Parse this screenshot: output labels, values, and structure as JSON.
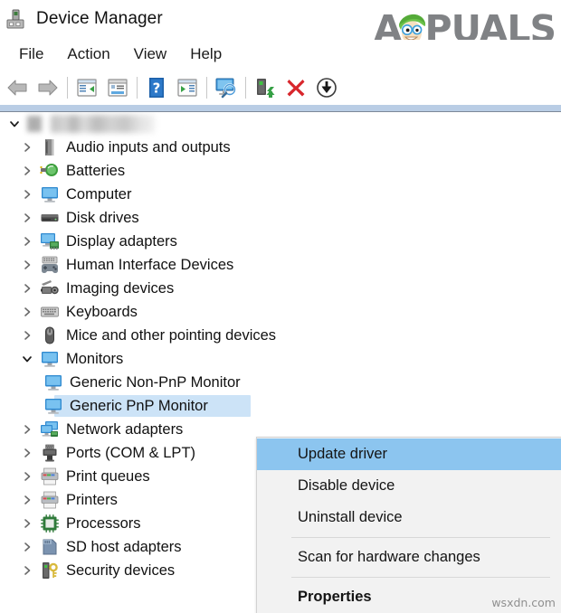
{
  "window": {
    "title": "Device Manager",
    "icon": "device-manager-icon"
  },
  "branding": {
    "logo_a": "A",
    "logo_rest": "PUALS",
    "watermark": "wsxdn.com"
  },
  "menubar": {
    "items": [
      {
        "label": "File",
        "name": "menu-file"
      },
      {
        "label": "Action",
        "name": "menu-action"
      },
      {
        "label": "View",
        "name": "menu-view"
      },
      {
        "label": "Help",
        "name": "menu-help"
      }
    ]
  },
  "toolbar": {
    "buttons": [
      {
        "name": "back-button",
        "icon": "back-arrow-icon",
        "tip": "Back"
      },
      {
        "name": "forward-button",
        "icon": "forward-arrow-icon",
        "tip": "Forward"
      },
      {
        "name": "show-hide-console-tree-button",
        "icon": "console-tree-icon",
        "tip": "Show/Hide Console Tree"
      },
      {
        "name": "properties-button",
        "icon": "properties-window-icon",
        "tip": "Properties"
      },
      {
        "name": "help-button",
        "icon": "help-question-icon",
        "tip": "Help"
      },
      {
        "name": "show-hide-action-pane-button",
        "icon": "action-pane-icon",
        "tip": "Show/Hide Action Pane"
      },
      {
        "name": "scan-for-hardware-changes-button",
        "icon": "scan-hardware-icon",
        "tip": "Scan for hardware changes"
      },
      {
        "name": "update-driver-button",
        "icon": "update-driver-icon",
        "tip": "Update driver"
      },
      {
        "name": "uninstall-device-button",
        "icon": "red-x-icon",
        "tip": "Uninstall device"
      },
      {
        "name": "disable-device-button",
        "icon": "circle-down-arrow-icon",
        "tip": "Disable device"
      }
    ]
  },
  "tree": {
    "root": {
      "label": "",
      "redacted": true,
      "expanded": true,
      "name": "tree-root-computer-name"
    },
    "items": [
      {
        "label": "Audio inputs and outputs",
        "icon": "speaker-icon",
        "indent": 1,
        "expanded": false,
        "selected": false
      },
      {
        "label": "Batteries",
        "icon": "battery-plug-icon",
        "indent": 1,
        "expanded": false,
        "selected": false
      },
      {
        "label": "Computer",
        "icon": "monitor-icon",
        "indent": 1,
        "expanded": false,
        "selected": false
      },
      {
        "label": "Disk drives",
        "icon": "disk-drive-icon",
        "indent": 1,
        "expanded": false,
        "selected": false
      },
      {
        "label": "Display adapters",
        "icon": "display-adapter-icon",
        "indent": 1,
        "expanded": false,
        "selected": false
      },
      {
        "label": "Human Interface Devices",
        "icon": "hid-gamepad-icon",
        "indent": 1,
        "expanded": false,
        "selected": false
      },
      {
        "label": "Imaging devices",
        "icon": "camera-icon",
        "indent": 1,
        "expanded": false,
        "selected": false
      },
      {
        "label": "Keyboards",
        "icon": "keyboard-icon",
        "indent": 1,
        "expanded": false,
        "selected": false
      },
      {
        "label": "Mice and other pointing devices",
        "icon": "mouse-icon",
        "indent": 1,
        "expanded": false,
        "selected": false
      },
      {
        "label": "Monitors",
        "icon": "monitor-icon",
        "indent": 1,
        "expanded": true,
        "selected": false
      },
      {
        "label": "Generic Non-PnP Monitor",
        "icon": "monitor-icon",
        "indent": 2,
        "expanded": null,
        "selected": false
      },
      {
        "label": "Generic PnP Monitor",
        "icon": "monitor-icon",
        "indent": 2,
        "expanded": null,
        "selected": true
      },
      {
        "label": "Network adapters",
        "icon": "network-adapter-icon",
        "indent": 1,
        "expanded": false,
        "selected": false
      },
      {
        "label": "Ports (COM & LPT)",
        "icon": "port-icon",
        "indent": 1,
        "expanded": false,
        "selected": false
      },
      {
        "label": "Print queues",
        "icon": "printer-icon",
        "indent": 1,
        "expanded": false,
        "selected": false
      },
      {
        "label": "Printers",
        "icon": "printer-icon",
        "indent": 1,
        "expanded": false,
        "selected": false
      },
      {
        "label": "Processors",
        "icon": "processor-icon",
        "indent": 1,
        "expanded": false,
        "selected": false
      },
      {
        "label": "SD host adapters",
        "icon": "sd-host-icon",
        "indent": 1,
        "expanded": false,
        "selected": false
      },
      {
        "label": "Security devices",
        "icon": "security-key-icon",
        "indent": 1,
        "expanded": false,
        "selected": false
      }
    ]
  },
  "context_menu": {
    "items": [
      {
        "label": "Update driver",
        "name": "ctx-update-driver",
        "highlight": true,
        "bold": false,
        "separator_after": false
      },
      {
        "label": "Disable device",
        "name": "ctx-disable-device",
        "highlight": false,
        "bold": false,
        "separator_after": false
      },
      {
        "label": "Uninstall device",
        "name": "ctx-uninstall-device",
        "highlight": false,
        "bold": false,
        "separator_after": true
      },
      {
        "label": "Scan for hardware changes",
        "name": "ctx-scan-hardware-changes",
        "highlight": false,
        "bold": false,
        "separator_after": true
      },
      {
        "label": "Properties",
        "name": "ctx-properties",
        "highlight": false,
        "bold": true,
        "separator_after": false
      }
    ]
  },
  "colors": {
    "selection": "#cce3f7",
    "menu_highlight": "#8cc5ef",
    "menu_bg": "#f2f2f2",
    "divider_strip": "#b9cde5",
    "logo_gray": "#808285",
    "mascot_hair": "#6cc24a"
  }
}
